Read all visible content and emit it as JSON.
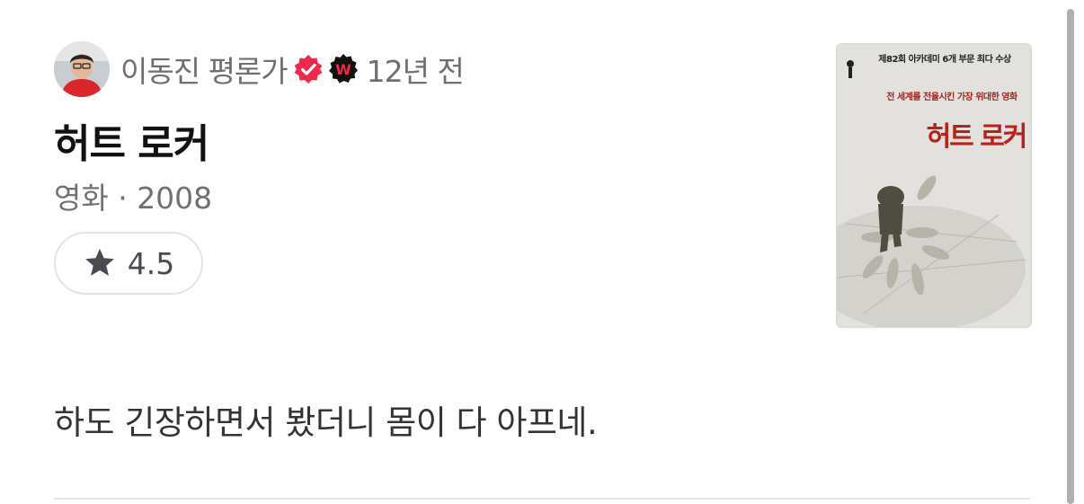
{
  "author": {
    "name": "이동진 평론가",
    "time_ago": "12년 전",
    "avatar_icon": "profile-photo",
    "verified_icon": "verified-badge-icon",
    "badge_icon": "watcha-w-icon",
    "accent_color": "#f0284a"
  },
  "title": "허트 로커",
  "meta": "영화 · 2008",
  "rating": {
    "icon": "star-icon",
    "value": "4.5"
  },
  "poster": {
    "top_line": "제82회 아카데미 6개 부문 최다 수상",
    "tagline": "전 세계를 전율시킨 가장 위대한 영화",
    "title": "허트 로커"
  },
  "comment": "하도 긴장하면서 봤더니 몸이 다 아프네."
}
